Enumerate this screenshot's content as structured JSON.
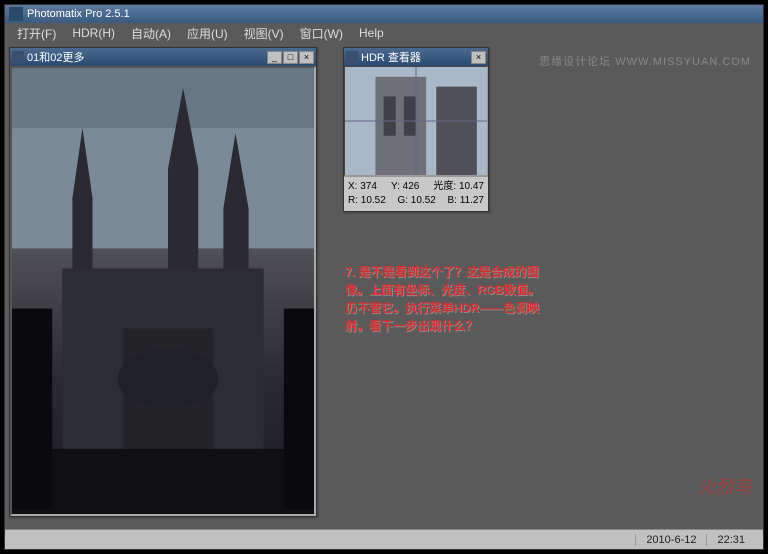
{
  "app": {
    "title": "Photomatix Pro 2.5.1"
  },
  "menu": {
    "open": "打开(F)",
    "hdr": "HDR(H)",
    "auto": "自动(A)",
    "app": "应用(U)",
    "view": "视图(V)",
    "window": "窗口(W)",
    "help": "Help"
  },
  "doc_window": {
    "title": "01和02更多"
  },
  "hdr_window": {
    "title": "HDR 查看器",
    "x_label": "X:",
    "x_val": "374",
    "y_label": "Y:",
    "y_val": "426",
    "lum_label": "光度:",
    "lum_val": "10.47",
    "r_label": "R:",
    "r_val": "10.52",
    "g_label": "G:",
    "g_val": "10.52",
    "b_label": "B:",
    "b_val": "11.27"
  },
  "annotation": {
    "text": "7. 是不是看到这个了？这是合成的图像。上面有坐标、光度、RGB数值。仍不管它。执行菜单HDR——色调映射。看下一步出现什么？"
  },
  "watermarks": {
    "top_right": "思缘设计论坛 WWW.MISSYUAN.COM",
    "bottom_right": "火烈鸟"
  },
  "status": {
    "date": "2010-6-12",
    "time": "22:31"
  }
}
